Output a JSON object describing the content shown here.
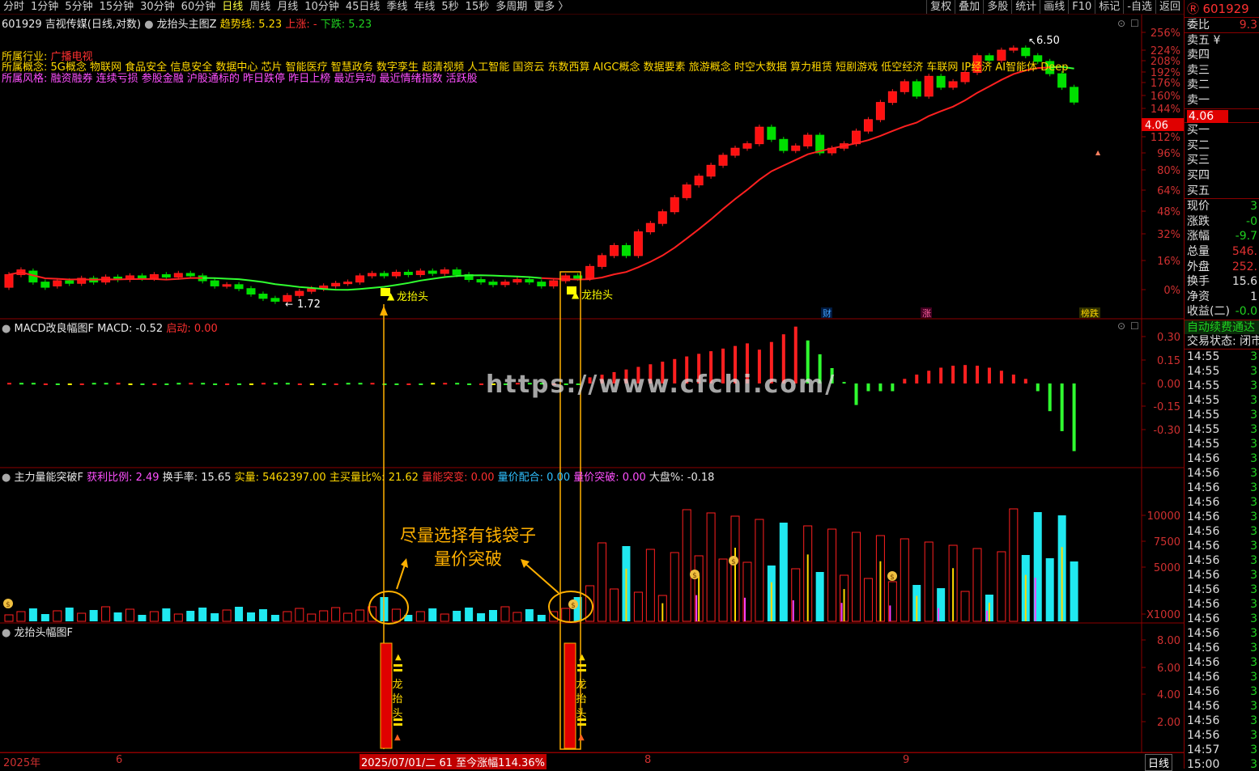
{
  "topbar": {
    "tabs": [
      "分时",
      "1分钟",
      "5分钟",
      "15分钟",
      "30分钟",
      "60分钟",
      "日线",
      "周线",
      "月线",
      "10分钟",
      "45日线",
      "季线",
      "年线",
      "5秒",
      "15秒",
      "多周期",
      "更多 〉"
    ],
    "active": "日线",
    "right_tools": [
      "复权",
      "叠加",
      "多股",
      "统计",
      "画线",
      "F10",
      "标记",
      "-自选",
      "返回"
    ]
  },
  "panel1": {
    "title": "601929 吉视传媒(日线,对数)",
    "indicator": "龙抬头主图Z",
    "trend_label": "趋势线: 5.23",
    "up_label": "上涨: -",
    "down_label": "下跌: 5.23",
    "industry_label": "所属行业:",
    "industry_value": "广播电视",
    "concept_label": "所属概念:",
    "concept_value": "5G概念 物联网 食品安全 信息安全 数据中心 芯片 智能医疗 智慧政务 数字孪生 超清视频 人工智能 国资云 东数西算 AIGC概念 数据要素 旅游概念 时空大数据 算力租赁 短剧游戏 低空经济 车联网 IP经济 AI智能体 Deep",
    "style_label": "所属风格:",
    "style_value": "融资融券 连续亏损 参股金融 沪股通标的 昨日跌停 昨日上榜 最近异动 最近情绪指数 活跃股",
    "high_label": "6.50",
    "low_label": "1.72",
    "signal_label_1": "龙抬头",
    "signal_label_2": "龙抬头",
    "price_tag": "4.06",
    "markers": [
      "财",
      "涨",
      "榜跌"
    ],
    "yticks": [
      "256%",
      "224%",
      "208%",
      "192%",
      "176%",
      "160%",
      "144%",
      "112%",
      "96%",
      "80%",
      "64%",
      "48%",
      "32%",
      "16%",
      "0%"
    ]
  },
  "panel2": {
    "title": "MACD改良幅图F",
    "macd": "MACD: -0.52",
    "start": "启动: 0.00",
    "yticks": [
      "0.30",
      "0.15",
      "0.00",
      "-0.15",
      "-0.30"
    ]
  },
  "panel3": {
    "title": "主力量能突破F",
    "profit_ratio": "获利比例: 2.49",
    "turnover": "换手率: 15.65",
    "volume": "实量: 5462397.00",
    "main_buy": "主买量比%: 21.62",
    "vol_break": "量能突变: 0.00",
    "vp_match": "量价配合: 0.00",
    "vp_break": "量价突破: 0.00",
    "market": "大盘%: -0.18",
    "annotation_1": "尽量选择有钱袋子",
    "annotation_2": "量价突破",
    "yticks": [
      "10000",
      "7500",
      "5000",
      "X1000"
    ]
  },
  "panel4": {
    "title": "龙抬头幅图F",
    "bar_text": "龙抬头",
    "yticks": [
      "8.00",
      "6.00",
      "4.00",
      "2.00"
    ]
  },
  "watermark": "https://www.cfchi.com/",
  "xaxis": {
    "year": "2025年",
    "m6": "6",
    "date_tip": "2025/07/01/二 61 至今涨幅114.36%",
    "m8": "8",
    "m9": "9",
    "period": "日线"
  },
  "sidebar": {
    "code": "601929",
    "weibi_label": "委比",
    "weibi_value": "9.3",
    "asks": [
      "卖五 ¥",
      "卖四",
      "卖三",
      "卖二",
      "卖一"
    ],
    "price_tag": "4.06",
    "bids": [
      "买一",
      "买二",
      "买三",
      "买四",
      "买五"
    ],
    "stats": [
      {
        "label": "现价",
        "value": "3"
      },
      {
        "label": "涨跌",
        "value": "-0"
      },
      {
        "label": "涨幅",
        "value": "-9.7"
      },
      {
        "label": "总量",
        "value": "546."
      },
      {
        "label": "外盘",
        "value": "252."
      },
      {
        "label": "换手",
        "value": "15.6"
      },
      {
        "label": "净资",
        "value": "1"
      },
      {
        "label": "收益(二)",
        "value": "-0.0"
      }
    ],
    "autopay": "自动续费通达",
    "trade_status": "交易状态: 闭市",
    "ticks_time": [
      "14:55",
      "14:55",
      "14:55",
      "14:55",
      "14:55",
      "14:55",
      "14:55",
      "14:56",
      "14:56",
      "14:56",
      "14:56",
      "14:56",
      "14:56",
      "14:56",
      "14:56",
      "14:56",
      "14:56",
      "14:56",
      "14:56",
      "14:56",
      "14:56",
      "14:56",
      "14:56",
      "14:56",
      "14:56",
      "14:56",
      "14:56",
      "14:57",
      "15:00"
    ],
    "ticks_val": "3"
  },
  "colors": {
    "up": "#ff2020",
    "down": "#00e0e0",
    "grid": "#8b0000",
    "ma": "#ff2020",
    "ma_down": "#20ff20",
    "signal": "#ffff00"
  },
  "chart_data": {
    "type": "candlestick",
    "candles": [
      {
        "o": 0.98,
        "c": 1.08
      },
      {
        "o": 1.08,
        "c": 1.12
      },
      {
        "o": 1.11,
        "c": 1.02
      },
      {
        "o": 1.02,
        "c": 0.98
      },
      {
        "o": 0.99,
        "c": 1.03
      },
      {
        "o": 1.03,
        "c": 1.01
      },
      {
        "o": 1.01,
        "c": 1.05
      },
      {
        "o": 1.05,
        "c": 1.02
      },
      {
        "o": 1.02,
        "c": 1.06
      },
      {
        "o": 1.06,
        "c": 1.04
      },
      {
        "o": 1.04,
        "c": 1.07
      },
      {
        "o": 1.07,
        "c": 1.05
      },
      {
        "o": 1.05,
        "c": 1.08
      },
      {
        "o": 1.08,
        "c": 1.06
      },
      {
        "o": 1.06,
        "c": 1.09
      },
      {
        "o": 1.09,
        "c": 1.07
      },
      {
        "o": 1.07,
        "c": 1.03
      },
      {
        "o": 1.03,
        "c": 0.99
      },
      {
        "o": 0.99,
        "c": 1.0
      },
      {
        "o": 1.0,
        "c": 0.97
      },
      {
        "o": 0.97,
        "c": 0.93
      },
      {
        "o": 0.93,
        "c": 0.9
      },
      {
        "o": 0.9,
        "c": 0.88
      },
      {
        "o": 0.88,
        "c": 0.92
      },
      {
        "o": 0.92,
        "c": 0.95
      },
      {
        "o": 0.95,
        "c": 0.97
      },
      {
        "o": 0.97,
        "c": 0.99
      },
      {
        "o": 0.99,
        "c": 1.01
      },
      {
        "o": 1.01,
        "c": 1.02
      },
      {
        "o": 1.02,
        "c": 1.07
      },
      {
        "o": 1.07,
        "c": 1.09
      },
      {
        "o": 1.09,
        "c": 1.07
      },
      {
        "o": 1.07,
        "c": 1.1
      },
      {
        "o": 1.1,
        "c": 1.08
      },
      {
        "o": 1.08,
        "c": 1.11
      },
      {
        "o": 1.11,
        "c": 1.09
      },
      {
        "o": 1.09,
        "c": 1.12
      },
      {
        "o": 1.12,
        "c": 1.08
      },
      {
        "o": 1.08,
        "c": 1.04
      },
      {
        "o": 1.04,
        "c": 1.02
      },
      {
        "o": 1.02,
        "c": 1.0
      },
      {
        "o": 1.0,
        "c": 1.02
      },
      {
        "o": 1.02,
        "c": 1.04
      },
      {
        "o": 1.04,
        "c": 1.02
      },
      {
        "o": 1.02,
        "c": 0.99
      },
      {
        "o": 0.99,
        "c": 1.03
      },
      {
        "o": 1.03,
        "c": 1.07
      },
      {
        "o": 1.07,
        "c": 1.05
      },
      {
        "o": 1.05,
        "c": 1.15
      },
      {
        "o": 1.15,
        "c": 1.25
      },
      {
        "o": 1.25,
        "c": 1.35
      },
      {
        "o": 1.35,
        "c": 1.25
      },
      {
        "o": 1.25,
        "c": 1.5
      },
      {
        "o": 1.5,
        "c": 1.6
      },
      {
        "o": 1.6,
        "c": 1.75
      },
      {
        "o": 1.75,
        "c": 1.95
      },
      {
        "o": 1.95,
        "c": 2.15
      },
      {
        "o": 2.15,
        "c": 2.3
      },
      {
        "o": 2.3,
        "c": 2.5
      },
      {
        "o": 2.5,
        "c": 2.7
      },
      {
        "o": 2.7,
        "c": 2.85
      },
      {
        "o": 2.85,
        "c": 2.95
      },
      {
        "o": 2.95,
        "c": 3.35
      },
      {
        "o": 3.35,
        "c": 3.05
      },
      {
        "o": 3.05,
        "c": 2.8
      },
      {
        "o": 2.8,
        "c": 2.9
      },
      {
        "o": 2.9,
        "c": 3.15
      },
      {
        "o": 3.15,
        "c": 2.75
      },
      {
        "o": 2.75,
        "c": 2.85
      },
      {
        "o": 2.85,
        "c": 2.95
      },
      {
        "o": 2.95,
        "c": 3.25
      },
      {
        "o": 3.25,
        "c": 3.55
      },
      {
        "o": 3.55,
        "c": 4.05
      },
      {
        "o": 4.05,
        "c": 4.4
      },
      {
        "o": 4.4,
        "c": 4.75
      },
      {
        "o": 4.75,
        "c": 4.25
      },
      {
        "o": 4.25,
        "c": 4.95
      },
      {
        "o": 4.95,
        "c": 4.55
      },
      {
        "o": 4.55,
        "c": 4.75
      },
      {
        "o": 4.75,
        "c": 5.1
      },
      {
        "o": 5.1,
        "c": 5.8
      },
      {
        "o": 5.8,
        "c": 5.6
      },
      {
        "o": 5.6,
        "c": 6.05
      },
      {
        "o": 6.05,
        "c": 6.15
      },
      {
        "o": 6.15,
        "c": 5.8
      },
      {
        "o": 5.8,
        "c": 5.55
      },
      {
        "o": 5.55,
        "c": 5.05
      },
      {
        "o": 5.05,
        "c": 4.55
      },
      {
        "o": 4.55,
        "c": 4.06
      }
    ]
  }
}
